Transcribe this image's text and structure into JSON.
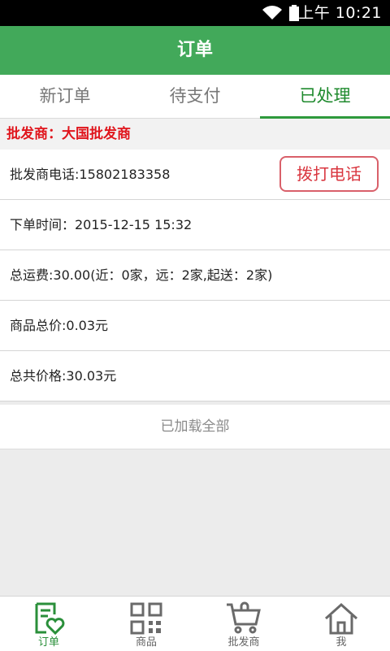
{
  "status_bar": {
    "time": "上午 10:21"
  },
  "header": {
    "title": "订单"
  },
  "tabs": [
    {
      "label": "新订单",
      "active": false
    },
    {
      "label": "待支付",
      "active": false
    },
    {
      "label": "已处理",
      "active": true
    }
  ],
  "wholesaler": {
    "label": "批发商：大国批发商"
  },
  "order": {
    "phone": "批发商电话:15802183358",
    "call_button": "拨打电话",
    "order_time": "下单时间：2015-12-15 15:32",
    "shipping": "总运费:30.00(近：0家，远：2家,起送：2家)",
    "goods_total": "商品总价:0.03元",
    "grand_total": "总共价格:30.03元"
  },
  "list_footer": "已加载全部",
  "bottom_nav": [
    {
      "label": "订单",
      "icon": "order-heart-icon",
      "active": true
    },
    {
      "label": "商品",
      "icon": "qr-code-icon",
      "active": false
    },
    {
      "label": "批发商",
      "icon": "shopping-cart-icon",
      "active": false
    },
    {
      "label": "我",
      "icon": "home-icon",
      "active": false
    }
  ],
  "colors": {
    "primary": "#42a95a",
    "accent_red": "#e0161d",
    "active_green": "#1f8a2e"
  }
}
